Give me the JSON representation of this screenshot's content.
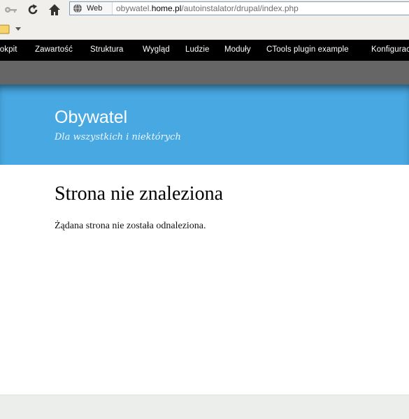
{
  "browser": {
    "url_badge": "Web",
    "url_host_prefix": "obywatel.",
    "url_host_main": "home.pl",
    "url_path": "/autoinstalator/drupal/index.php"
  },
  "admin_menu": {
    "items": [
      "Kokpit",
      "Zawartość",
      "Struktura",
      "Wygląd",
      "Ludzie",
      "Moduły",
      "CTools plugin example",
      "Konfiguracja"
    ]
  },
  "site": {
    "name": "Obywatel",
    "slogan": "Dla wszystkich i niektórych"
  },
  "page": {
    "title": "Strona nie znaleziona",
    "message": "Żądana strona nie została odnaleziona."
  },
  "colors": {
    "header_blue": "#48a8e2",
    "admin_black": "#000000",
    "subbar_gray": "#666666"
  },
  "icons": [
    "key-icon",
    "reload-icon",
    "home-icon",
    "globe-icon",
    "bookmark-folder-icon",
    "dropdown-arrow-icon"
  ]
}
